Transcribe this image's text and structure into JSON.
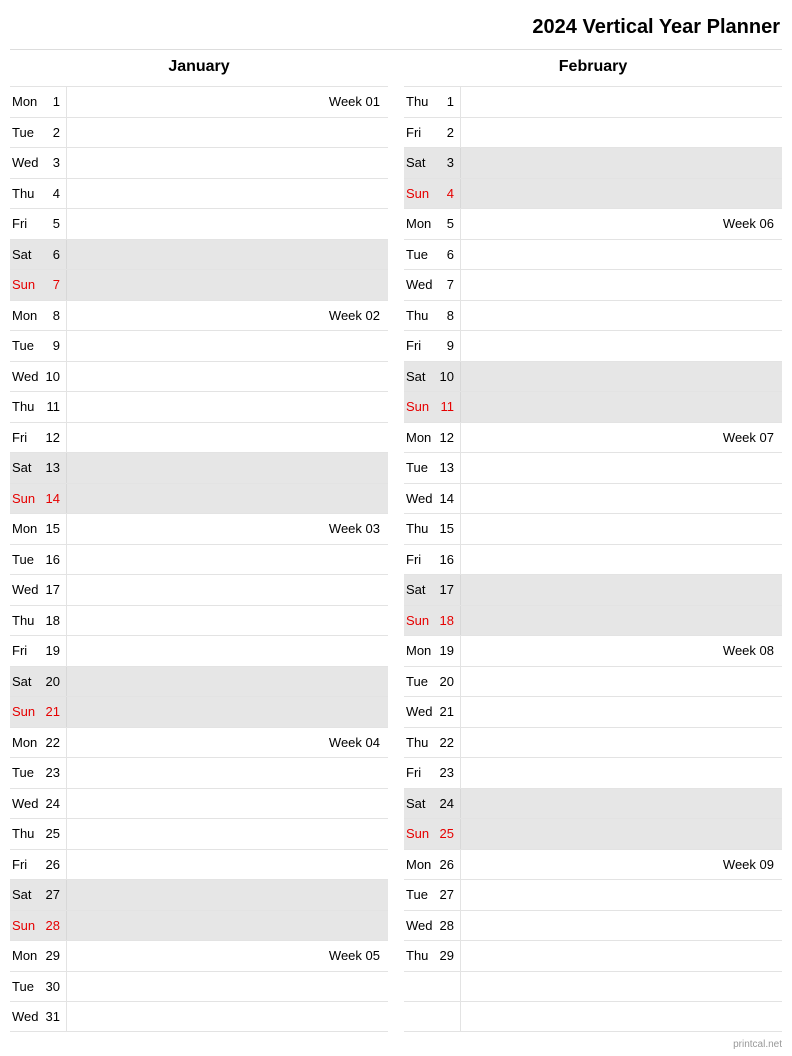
{
  "title": "2024 Vertical Year Planner",
  "footer": "printcal.net",
  "months": [
    {
      "name": "January",
      "days": [
        {
          "dow": "Mon",
          "num": "1",
          "note": "Week 01",
          "weekend": false,
          "sunday": false
        },
        {
          "dow": "Tue",
          "num": "2",
          "note": "",
          "weekend": false,
          "sunday": false
        },
        {
          "dow": "Wed",
          "num": "3",
          "note": "",
          "weekend": false,
          "sunday": false
        },
        {
          "dow": "Thu",
          "num": "4",
          "note": "",
          "weekend": false,
          "sunday": false
        },
        {
          "dow": "Fri",
          "num": "5",
          "note": "",
          "weekend": false,
          "sunday": false
        },
        {
          "dow": "Sat",
          "num": "6",
          "note": "",
          "weekend": true,
          "sunday": false
        },
        {
          "dow": "Sun",
          "num": "7",
          "note": "",
          "weekend": true,
          "sunday": true
        },
        {
          "dow": "Mon",
          "num": "8",
          "note": "Week 02",
          "weekend": false,
          "sunday": false
        },
        {
          "dow": "Tue",
          "num": "9",
          "note": "",
          "weekend": false,
          "sunday": false
        },
        {
          "dow": "Wed",
          "num": "10",
          "note": "",
          "weekend": false,
          "sunday": false
        },
        {
          "dow": "Thu",
          "num": "11",
          "note": "",
          "weekend": false,
          "sunday": false
        },
        {
          "dow": "Fri",
          "num": "12",
          "note": "",
          "weekend": false,
          "sunday": false
        },
        {
          "dow": "Sat",
          "num": "13",
          "note": "",
          "weekend": true,
          "sunday": false
        },
        {
          "dow": "Sun",
          "num": "14",
          "note": "",
          "weekend": true,
          "sunday": true
        },
        {
          "dow": "Mon",
          "num": "15",
          "note": "Week 03",
          "weekend": false,
          "sunday": false
        },
        {
          "dow": "Tue",
          "num": "16",
          "note": "",
          "weekend": false,
          "sunday": false
        },
        {
          "dow": "Wed",
          "num": "17",
          "note": "",
          "weekend": false,
          "sunday": false
        },
        {
          "dow": "Thu",
          "num": "18",
          "note": "",
          "weekend": false,
          "sunday": false
        },
        {
          "dow": "Fri",
          "num": "19",
          "note": "",
          "weekend": false,
          "sunday": false
        },
        {
          "dow": "Sat",
          "num": "20",
          "note": "",
          "weekend": true,
          "sunday": false
        },
        {
          "dow": "Sun",
          "num": "21",
          "note": "",
          "weekend": true,
          "sunday": true
        },
        {
          "dow": "Mon",
          "num": "22",
          "note": "Week 04",
          "weekend": false,
          "sunday": false
        },
        {
          "dow": "Tue",
          "num": "23",
          "note": "",
          "weekend": false,
          "sunday": false
        },
        {
          "dow": "Wed",
          "num": "24",
          "note": "",
          "weekend": false,
          "sunday": false
        },
        {
          "dow": "Thu",
          "num": "25",
          "note": "",
          "weekend": false,
          "sunday": false
        },
        {
          "dow": "Fri",
          "num": "26",
          "note": "",
          "weekend": false,
          "sunday": false
        },
        {
          "dow": "Sat",
          "num": "27",
          "note": "",
          "weekend": true,
          "sunday": false
        },
        {
          "dow": "Sun",
          "num": "28",
          "note": "",
          "weekend": true,
          "sunday": true
        },
        {
          "dow": "Mon",
          "num": "29",
          "note": "Week 05",
          "weekend": false,
          "sunday": false
        },
        {
          "dow": "Tue",
          "num": "30",
          "note": "",
          "weekend": false,
          "sunday": false
        },
        {
          "dow": "Wed",
          "num": "31",
          "note": "",
          "weekend": false,
          "sunday": false
        }
      ]
    },
    {
      "name": "February",
      "days": [
        {
          "dow": "Thu",
          "num": "1",
          "note": "",
          "weekend": false,
          "sunday": false
        },
        {
          "dow": "Fri",
          "num": "2",
          "note": "",
          "weekend": false,
          "sunday": false
        },
        {
          "dow": "Sat",
          "num": "3",
          "note": "",
          "weekend": true,
          "sunday": false
        },
        {
          "dow": "Sun",
          "num": "4",
          "note": "",
          "weekend": true,
          "sunday": true
        },
        {
          "dow": "Mon",
          "num": "5",
          "note": "Week 06",
          "weekend": false,
          "sunday": false
        },
        {
          "dow": "Tue",
          "num": "6",
          "note": "",
          "weekend": false,
          "sunday": false
        },
        {
          "dow": "Wed",
          "num": "7",
          "note": "",
          "weekend": false,
          "sunday": false
        },
        {
          "dow": "Thu",
          "num": "8",
          "note": "",
          "weekend": false,
          "sunday": false
        },
        {
          "dow": "Fri",
          "num": "9",
          "note": "",
          "weekend": false,
          "sunday": false
        },
        {
          "dow": "Sat",
          "num": "10",
          "note": "",
          "weekend": true,
          "sunday": false
        },
        {
          "dow": "Sun",
          "num": "11",
          "note": "",
          "weekend": true,
          "sunday": true
        },
        {
          "dow": "Mon",
          "num": "12",
          "note": "Week 07",
          "weekend": false,
          "sunday": false
        },
        {
          "dow": "Tue",
          "num": "13",
          "note": "",
          "weekend": false,
          "sunday": false
        },
        {
          "dow": "Wed",
          "num": "14",
          "note": "",
          "weekend": false,
          "sunday": false
        },
        {
          "dow": "Thu",
          "num": "15",
          "note": "",
          "weekend": false,
          "sunday": false
        },
        {
          "dow": "Fri",
          "num": "16",
          "note": "",
          "weekend": false,
          "sunday": false
        },
        {
          "dow": "Sat",
          "num": "17",
          "note": "",
          "weekend": true,
          "sunday": false
        },
        {
          "dow": "Sun",
          "num": "18",
          "note": "",
          "weekend": true,
          "sunday": true
        },
        {
          "dow": "Mon",
          "num": "19",
          "note": "Week 08",
          "weekend": false,
          "sunday": false
        },
        {
          "dow": "Tue",
          "num": "20",
          "note": "",
          "weekend": false,
          "sunday": false
        },
        {
          "dow": "Wed",
          "num": "21",
          "note": "",
          "weekend": false,
          "sunday": false
        },
        {
          "dow": "Thu",
          "num": "22",
          "note": "",
          "weekend": false,
          "sunday": false
        },
        {
          "dow": "Fri",
          "num": "23",
          "note": "",
          "weekend": false,
          "sunday": false
        },
        {
          "dow": "Sat",
          "num": "24",
          "note": "",
          "weekend": true,
          "sunday": false
        },
        {
          "dow": "Sun",
          "num": "25",
          "note": "",
          "weekend": true,
          "sunday": true
        },
        {
          "dow": "Mon",
          "num": "26",
          "note": "Week 09",
          "weekend": false,
          "sunday": false
        },
        {
          "dow": "Tue",
          "num": "27",
          "note": "",
          "weekend": false,
          "sunday": false
        },
        {
          "dow": "Wed",
          "num": "28",
          "note": "",
          "weekend": false,
          "sunday": false
        },
        {
          "dow": "Thu",
          "num": "29",
          "note": "",
          "weekend": false,
          "sunday": false
        },
        {
          "dow": "",
          "num": "",
          "note": "",
          "weekend": false,
          "sunday": false
        },
        {
          "dow": "",
          "num": "",
          "note": "",
          "weekend": false,
          "sunday": false
        }
      ]
    }
  ]
}
